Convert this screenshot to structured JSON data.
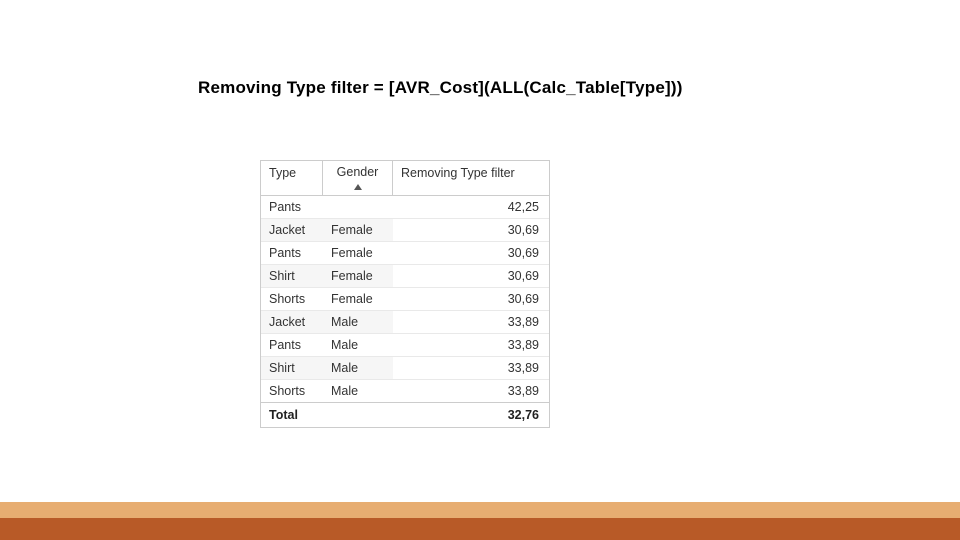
{
  "title": "Removing Type filter = [AVR_Cost](ALL(Calc_Table[Type]))",
  "table": {
    "headers": {
      "type": "Type",
      "gender": "Gender",
      "value": "Removing Type filter"
    },
    "sort_icon": "sort-asc-icon",
    "rows": [
      {
        "type": "Pants",
        "gender": "",
        "value": "42,25"
      },
      {
        "type": "Jacket",
        "gender": "Female",
        "value": "30,69"
      },
      {
        "type": "Pants",
        "gender": "Female",
        "value": "30,69"
      },
      {
        "type": "Shirt",
        "gender": "Female",
        "value": "30,69"
      },
      {
        "type": "Shorts",
        "gender": "Female",
        "value": "30,69"
      },
      {
        "type": "Jacket",
        "gender": "Male",
        "value": "33,89"
      },
      {
        "type": "Pants",
        "gender": "Male",
        "value": "33,89"
      },
      {
        "type": "Shirt",
        "gender": "Male",
        "value": "33,89"
      },
      {
        "type": "Shorts",
        "gender": "Male",
        "value": "33,89"
      }
    ],
    "total": {
      "label": "Total",
      "gender": "",
      "value": "32,76"
    }
  },
  "colors": {
    "footer_tan": "#e7ad71",
    "footer_rust": "#b85a27"
  },
  "chart_data": {
    "type": "table",
    "title": "Removing Type filter = [AVR_Cost](ALL(Calc_Table[Type]))",
    "columns": [
      "Type",
      "Gender",
      "Removing Type filter"
    ],
    "rows": [
      [
        "Pants",
        "",
        42.25
      ],
      [
        "Jacket",
        "Female",
        30.69
      ],
      [
        "Pants",
        "Female",
        30.69
      ],
      [
        "Shirt",
        "Female",
        30.69
      ],
      [
        "Shorts",
        "Female",
        30.69
      ],
      [
        "Jacket",
        "Male",
        33.89
      ],
      [
        "Pants",
        "Male",
        33.89
      ],
      [
        "Shirt",
        "Male",
        33.89
      ],
      [
        "Shorts",
        "Male",
        33.89
      ]
    ],
    "total": [
      "Total",
      "",
      32.76
    ]
  }
}
